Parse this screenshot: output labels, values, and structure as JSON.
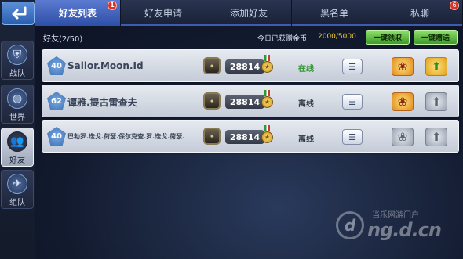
{
  "tabs": [
    {
      "label": "好友列表",
      "badge": "1",
      "active": true
    },
    {
      "label": "好友申请",
      "badge": "",
      "active": false
    },
    {
      "label": "添加好友",
      "badge": "",
      "active": false
    },
    {
      "label": "黑名单",
      "badge": "",
      "active": false
    },
    {
      "label": "私聊",
      "badge": "6",
      "active": false
    }
  ],
  "sidebar": {
    "items": [
      {
        "label": "战队",
        "icon": "shield-icon"
      },
      {
        "label": "世界",
        "icon": "globe-icon"
      },
      {
        "label": "好友",
        "icon": "friends-icon",
        "active": true
      },
      {
        "label": "组队",
        "icon": "jet-icon"
      }
    ]
  },
  "header": {
    "friend_count": "好友(2/50)",
    "gold_label": "今日已获赠金币:",
    "gold_value": "2000/5000",
    "collect_all": "一键领取",
    "send_all": "一键赠送"
  },
  "friends": [
    {
      "level": "40",
      "name": "Sailor.Moon.Id",
      "score": "28814",
      "status": "在线",
      "status_color": "#2e9a2e",
      "gift_claim": "available",
      "gift_send": "available"
    },
    {
      "level": "62",
      "name": "谭雅.提古雷查夫",
      "score": "28814",
      "status": "离线",
      "status_color": "#333a48",
      "gift_claim": "available",
      "gift_send": "unavailable"
    },
    {
      "level": "40",
      "name": "巴勃罗.迭戈.荷瑟.保尔克查.罗.迭戈.荷瑟.",
      "score": "28814",
      "status": "离线",
      "status_color": "#333a48",
      "gift_claim": "unavailable",
      "gift_send": "unavailable"
    }
  ],
  "watermark": {
    "top": "当乐网游门户",
    "main": "ng.d.cn",
    "logo": "d"
  }
}
